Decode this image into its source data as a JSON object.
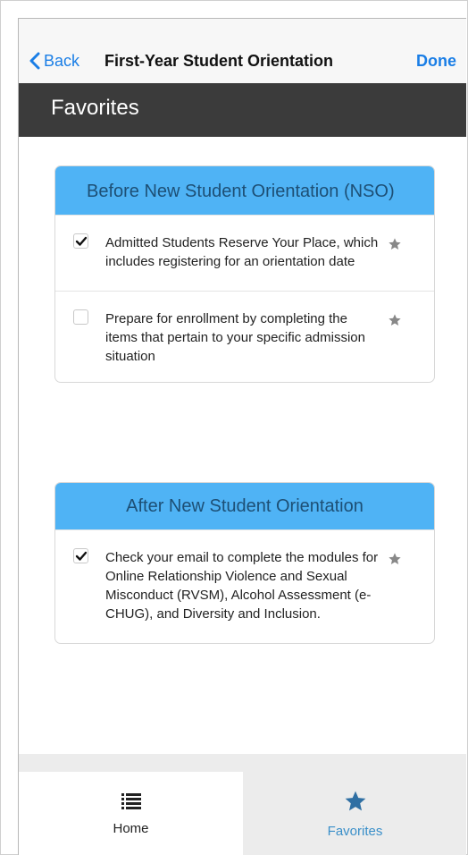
{
  "nav": {
    "back_label": "Back",
    "title": "First-Year Student Orientation",
    "done_label": "Done"
  },
  "header": {
    "title": "Favorites"
  },
  "sections": [
    {
      "title": "Before New Student Orientation (NSO)",
      "tasks": [
        {
          "text": "Admitted Students Reserve Your Place, which includes registering for an orientation date",
          "checked": true,
          "favorite": true
        },
        {
          "text": "Prepare for enrollment by completing the items that pertain to your specific admission situation",
          "checked": false,
          "favorite": true
        }
      ]
    },
    {
      "title": "After New Student Orientation",
      "tasks": [
        {
          "text": "Check your email to complete the modules for Online Relationship Violence and Sexual Misconduct (RVSM), Alcohol Assessment (e-CHUG), and Diversity and Inclusion.",
          "checked": true,
          "favorite": true
        }
      ]
    }
  ],
  "tabbar": {
    "home_label": "Home",
    "favorites_label": "Favorites",
    "home_icon": "list-icon",
    "favorites_icon": "star-icon",
    "active_tab": "Favorites"
  },
  "colors": {
    "accent": "#1a7ee6",
    "header_bg": "#3b3b3b",
    "section_header_bg": "#4fb3f5",
    "section_header_text": "#1d4f75",
    "active_tab_text": "#3a8fc9",
    "star_gray": "#888888"
  }
}
